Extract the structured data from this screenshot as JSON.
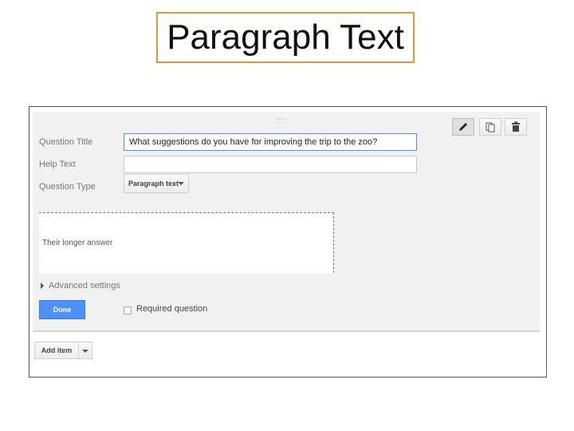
{
  "slide": {
    "title": "Paragraph Text"
  },
  "form": {
    "drag_handle": "::::",
    "question_title": {
      "label": "Question Title",
      "value": "What suggestions do you have for improving the trip to the zoo?"
    },
    "help_text": {
      "label": "Help Text",
      "value": ""
    },
    "question_type": {
      "label": "Question Type",
      "selected": "Paragraph text"
    },
    "preview": {
      "placeholder": "Their longer answer"
    },
    "advanced": {
      "label": "Advanced settings"
    },
    "done_label": "Done",
    "required": {
      "label": "Required question",
      "checked": false
    },
    "toolbar": {
      "icons": [
        "pencil-icon",
        "copy-icon",
        "trash-icon"
      ]
    },
    "add_item_label": "Add item"
  },
  "colors": {
    "accent": "#4d90fe",
    "title_border": "#e0963f"
  }
}
